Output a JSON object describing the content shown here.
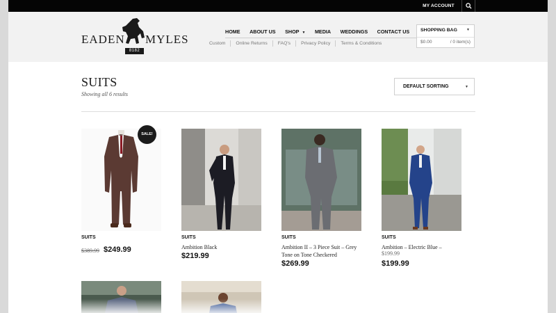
{
  "topbar": {
    "account_label": "MY ACCOUNT",
    "search_icon": "search-icon"
  },
  "logo": {
    "word_left": "EADEN",
    "word_right": "MYLES",
    "badge": "8182"
  },
  "nav": {
    "main": [
      "HOME",
      "ABOUT US",
      "SHOP",
      "MEDIA",
      "WEDDINGS",
      "CONTACT US"
    ],
    "shop_has_dropdown": true,
    "sub": [
      "Custom",
      "Online Returns",
      "FAQ's",
      "Privacy Policy",
      "Terms & Conditions"
    ]
  },
  "bag": {
    "title": "SHOPPING BAG",
    "amount": "$0.00",
    "items": "/ 0 item(s)"
  },
  "page": {
    "title": "SUITS",
    "results": "Showing all 6 results",
    "sort_label": "DEFAULT SORTING"
  },
  "products": [
    {
      "category": "SUITS",
      "name": "",
      "old_price": "$389.99",
      "price": "$249.99",
      "sale_badge": "SALE!",
      "suit_color": "#5b3a33"
    },
    {
      "category": "SUITS",
      "name": "Ambition Black",
      "price": "$219.99",
      "suit_color": "#1c1c24"
    },
    {
      "category": "SUITS",
      "name": "Ambition II – 3 Piece Suit – Grey Tone on Tone Checkered",
      "price": "$269.99",
      "suit_color": "#6b6d72"
    },
    {
      "category": "SUITS",
      "name": "Ambition – Electric Blue –",
      "old_price": "$199.99",
      "price": "$199.99",
      "suit_color": "#24438a"
    }
  ],
  "colors": {
    "topbar": "#050505",
    "header": "#f2f2f2",
    "text": "#111111"
  }
}
